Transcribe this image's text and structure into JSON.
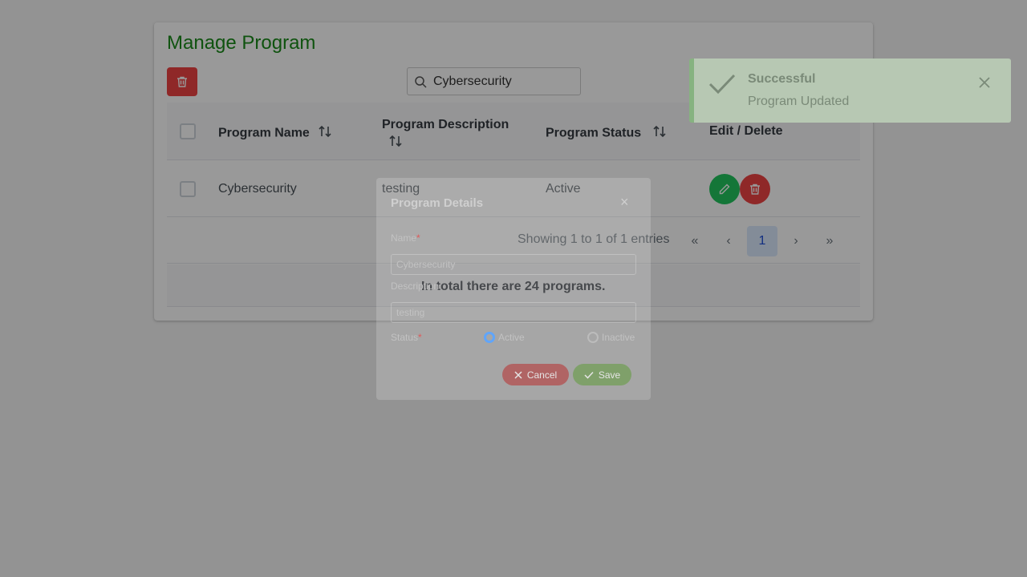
{
  "page": {
    "title": "Manage Program"
  },
  "search": {
    "value": "Cybersecurity"
  },
  "table": {
    "headers": {
      "name": "Program Name",
      "description": "Program Description",
      "status": "Program Status",
      "actions": "Edit / Delete"
    },
    "rows": [
      {
        "name": "Cybersecurity",
        "description": "testing",
        "status": "Active"
      }
    ]
  },
  "paginator": {
    "info": "Showing 1 to 1 of 1 entries",
    "current_page": "1",
    "first_icon": "«",
    "prev_icon": "‹",
    "next_icon": "›",
    "last_icon": "»"
  },
  "footer": {
    "text": "In total there are 24 programs."
  },
  "dialog": {
    "title": "Program Details",
    "close_icon": "×",
    "name_label": "Name",
    "name_value": "Cybersecurity",
    "description_label": "Description",
    "description_value": "testing",
    "status_label": "Status",
    "required_mark": "*",
    "status_options": [
      "Active",
      "Inactive"
    ],
    "selected_status": "Active",
    "cancel_label": "Cancel",
    "save_label": "Save"
  },
  "toast": {
    "title": "Successful",
    "message": "Program Updated"
  },
  "colors": {
    "title_green": "#1a8a1a",
    "danger": "#ef4444",
    "success": "#22c55e",
    "overlay": "rgba(0,0,0,0.4)"
  },
  "icons": {
    "toolbar_delete": "trash-icon",
    "search": "search-icon",
    "sort": "sort-icon",
    "edit": "pencil-icon",
    "delete": "trash-icon",
    "toast_check": "check-icon",
    "toast_close": "close-icon"
  }
}
